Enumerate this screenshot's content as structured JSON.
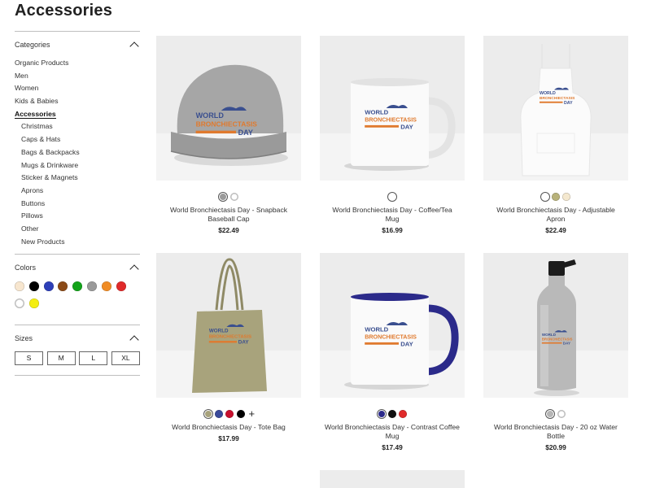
{
  "page": {
    "title": "Accessories"
  },
  "sidebar": {
    "categories_label": "Categories",
    "categories": [
      {
        "label": "Organic Products",
        "sub": false,
        "active": false
      },
      {
        "label": "Men",
        "sub": false,
        "active": false
      },
      {
        "label": "Women",
        "sub": false,
        "active": false
      },
      {
        "label": "Kids & Babies",
        "sub": false,
        "active": false
      },
      {
        "label": "Accessories",
        "sub": false,
        "active": true
      },
      {
        "label": "Christmas",
        "sub": true,
        "active": false
      },
      {
        "label": "Caps & Hats",
        "sub": true,
        "active": false
      },
      {
        "label": "Bags & Backpacks",
        "sub": true,
        "active": false
      },
      {
        "label": "Mugs & Drinkware",
        "sub": true,
        "active": false
      },
      {
        "label": "Sticker & Magnets",
        "sub": true,
        "active": false
      },
      {
        "label": "Aprons",
        "sub": true,
        "active": false
      },
      {
        "label": "Buttons",
        "sub": true,
        "active": false
      },
      {
        "label": "Pillows",
        "sub": true,
        "active": false
      },
      {
        "label": "Other",
        "sub": true,
        "active": false
      },
      {
        "label": "New Products",
        "sub": true,
        "active": false
      }
    ],
    "colors_label": "Colors",
    "colors": [
      "#f7e6cf",
      "#000000",
      "#2d3fb8",
      "#8b4a17",
      "#13a31a",
      "#9a9a9a",
      "#f08c25",
      "#e02a2a",
      "#ffffff",
      "#f4ee10"
    ],
    "sizes_label": "Sizes",
    "sizes": [
      "S",
      "M",
      "L",
      "XL"
    ]
  },
  "products": [
    {
      "name": "World Bronchiectasis Day - Snapback Baseball Cap",
      "price": "$22.49",
      "colors": [
        "#9a9a9a",
        "#ffffff"
      ],
      "selected": 0,
      "more": false,
      "icon": "cap"
    },
    {
      "name": "World Bronchiectasis Day - Coffee/Tea Mug",
      "price": "$16.99",
      "colors": [
        "#ffffff"
      ],
      "selected": 0,
      "more": false,
      "icon": "mug"
    },
    {
      "name": "World Bronchiectasis Day - Adjustable Apron",
      "price": "$22.49",
      "colors": [
        "#ffffff",
        "#b8b27a",
        "#f4e8cf"
      ],
      "selected": 0,
      "more": false,
      "icon": "apron"
    },
    {
      "name": "World Bronchiectasis Day - Tote Bag",
      "price": "$17.99",
      "colors": [
        "#a8a37c",
        "#3a4a9a",
        "#c8102e",
        "#000000"
      ],
      "selected": 0,
      "more": true,
      "icon": "tote"
    },
    {
      "name": "World Bronchiectasis Day - Contrast Coffee Mug",
      "price": "$17.49",
      "colors": [
        "#2b2a8a",
        "#111111",
        "#e02a2a"
      ],
      "selected": 0,
      "more": false,
      "icon": "contrast-mug"
    },
    {
      "name": "World Bronchiectasis Day - 20 oz Water Bottle",
      "price": "$20.99",
      "colors": [
        "#b5b5b5",
        "#ffffff"
      ],
      "selected": 0,
      "more": false,
      "icon": "bottle"
    }
  ],
  "more_symbol": "+"
}
